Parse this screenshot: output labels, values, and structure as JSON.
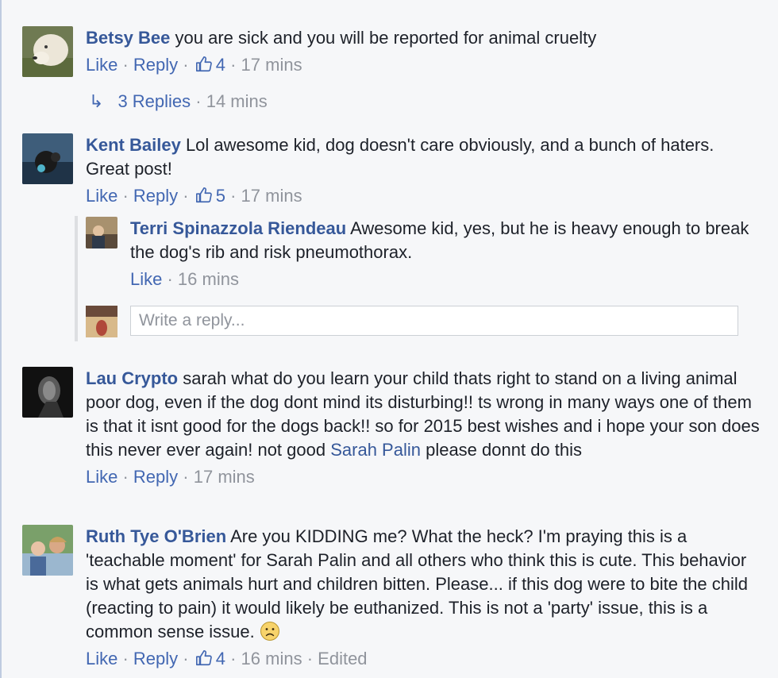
{
  "comments": [
    {
      "name": "Betsy Bee",
      "text": " you are sick and you will be reported for animal cruelty",
      "like": "Like",
      "reply": "Reply",
      "likes": "4",
      "time": "17 mins",
      "replies_label": "3 Replies",
      "replies_time": "14 mins"
    },
    {
      "name": "Kent Bailey",
      "text": " Lol awesome kid, dog doesn't care obviously, and a bunch of haters. Great post!",
      "like": "Like",
      "reply": "Reply",
      "likes": "5",
      "time": "17 mins"
    },
    {
      "name": "Lau Crypto",
      "text": " sarah what do you learn your child thats right to stand on a living animal poor dog, even if the dog dont mind its disturbing!! ts wrong in many ways one of them is that it isnt good for the dogs back!! so for 2015 best wishes and i hope your son does this never ever again! not good ",
      "mention": "Sarah Palin",
      "text2": " please donnt do this",
      "like": "Like",
      "reply": "Reply",
      "time": "17 mins"
    },
    {
      "name": "Ruth Tye O'Brien",
      "text": " Are you KIDDING me? What the heck? I'm praying this is a 'teachable moment' for Sarah Palin and all others who think this is cute. This behavior is what gets animals hurt and children bitten. Please... if this dog were to bite the child (reacting to pain) it would likely be euthanized. This is not a 'party' issue, this is a common sense issue. ",
      "like": "Like",
      "reply": "Reply",
      "likes": "4",
      "time": "16 mins",
      "edited": "Edited"
    }
  ],
  "reply": {
    "name": "Terri Spinazzola Riendeau",
    "text": " Awesome kid, yes, but he is heavy enough to break the dog's rib and risk pneumothorax.",
    "like": "Like",
    "time": "16 mins"
  },
  "reply_box": {
    "placeholder": "Write a reply..."
  },
  "separator": " · ",
  "colors": {
    "name": "#365899",
    "action": "#4267b2",
    "meta": "#90949c",
    "background": "#f6f7f9"
  },
  "icons": [
    "thumbs-up-icon",
    "reply-arrow-icon",
    "frown-emoji-icon"
  ]
}
